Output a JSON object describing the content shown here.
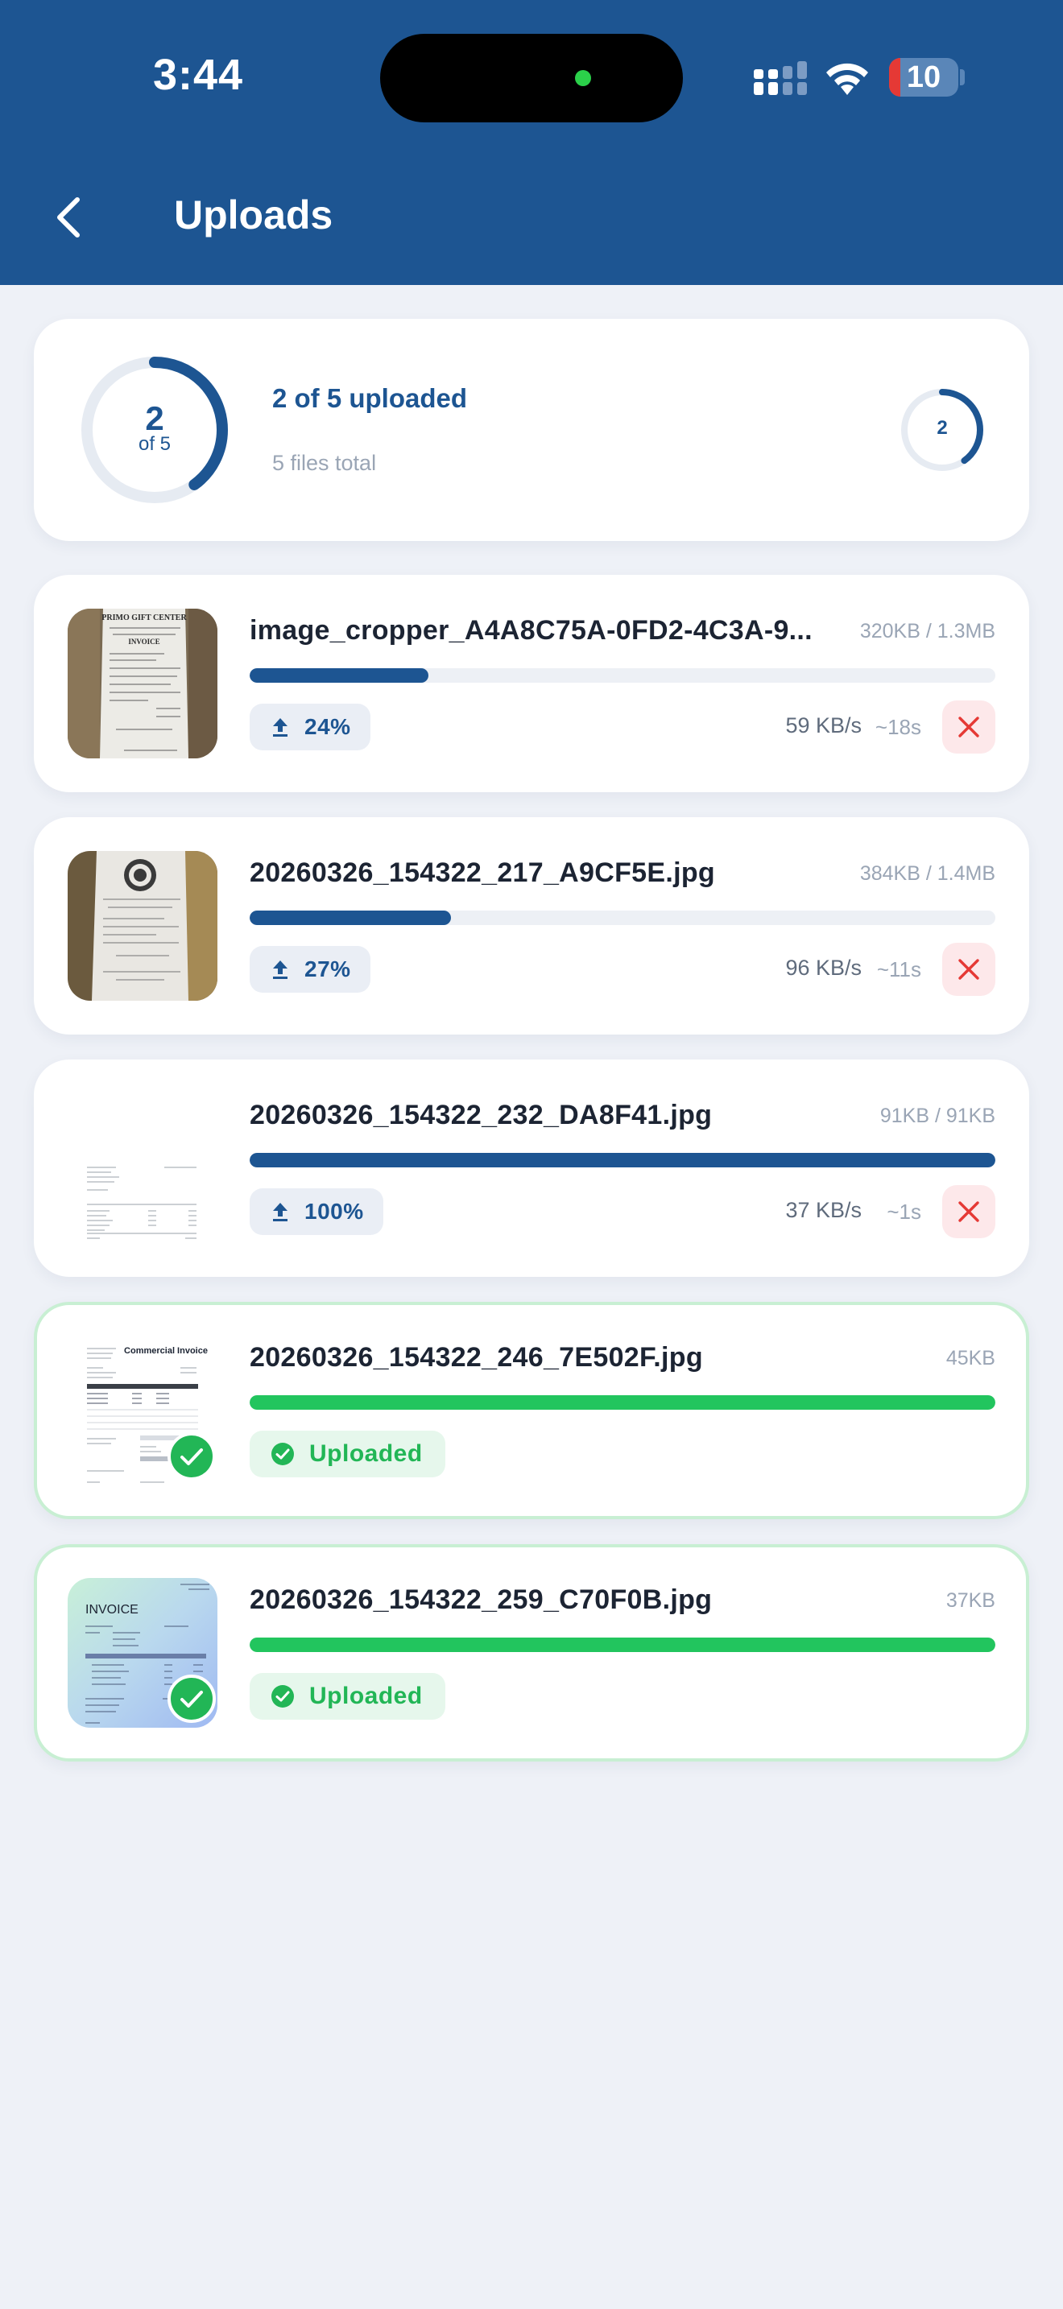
{
  "status_bar": {
    "time": "3:44",
    "battery": "10"
  },
  "header": {
    "title": "Uploads"
  },
  "summary": {
    "count": "2",
    "of_label": "of 5",
    "title": "2 of 5 uploaded",
    "subtitle": "5 files total",
    "badge": "2",
    "progress_fraction": 0.4
  },
  "files": [
    {
      "name": "image_cropper_A4A8C75A-0FD2-4C3A-9...",
      "size": "320KB / 1.3MB",
      "progress": 0.24,
      "percent": "24%",
      "speed": "59 KB/s",
      "eta": "~18s",
      "status": "uploading"
    },
    {
      "name": "20260326_154322_217_A9CF5E.jpg",
      "size": "384KB / 1.4MB",
      "progress": 0.27,
      "percent": "27%",
      "speed": "96 KB/s",
      "eta": "~11s",
      "status": "uploading"
    },
    {
      "name": "20260326_154322_232_DA8F41.jpg",
      "size": "91KB / 91KB",
      "progress": 1.0,
      "percent": "100%",
      "speed": "37 KB/s",
      "eta": "~1s",
      "status": "uploading"
    },
    {
      "name": "20260326_154322_246_7E502F.jpg",
      "size": "45KB",
      "progress": 1.0,
      "status_label": "Uploaded",
      "status": "done"
    },
    {
      "name": "20260326_154322_259_C70F0B.jpg",
      "size": "37KB",
      "progress": 1.0,
      "status_label": "Uploaded",
      "status": "done"
    }
  ],
  "thumbnail_text": {
    "receipt_1_store": "PRIMO GIFT CENTER",
    "receipt_1_doc": "INVOICE",
    "doc_4_title": "Commercial Invoice",
    "doc_5_title": "INVOICE"
  },
  "colors": {
    "brand": "#1d5592",
    "success": "#22c55e",
    "danger": "#e53935",
    "background": "#eef1f7"
  }
}
